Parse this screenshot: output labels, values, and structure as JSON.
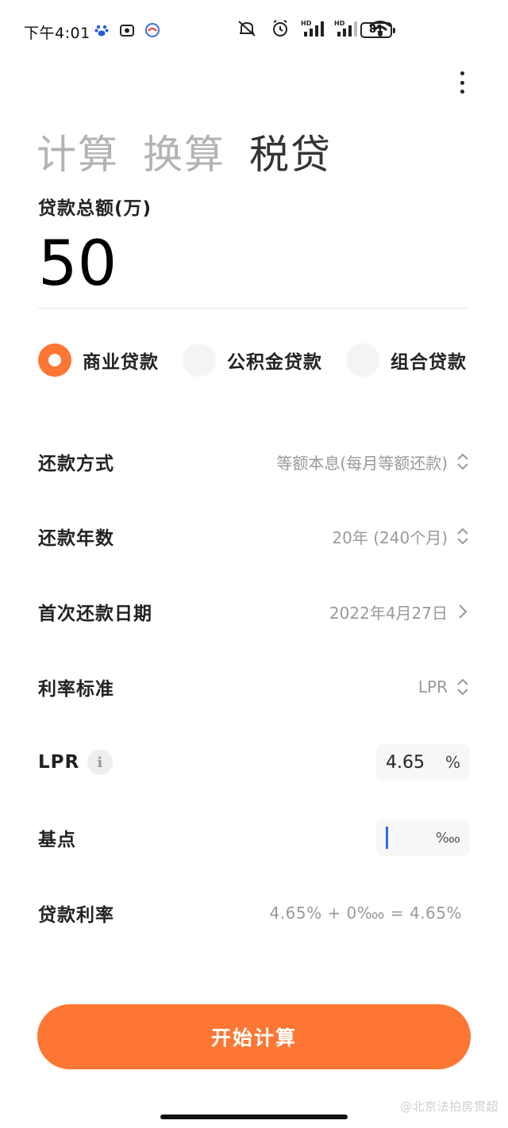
{
  "status_bar": {
    "time": "下午4:01",
    "battery": "81",
    "net_hd_1": "HD",
    "net_hd_2": "HD"
  },
  "tabs": [
    {
      "label": "计算",
      "active": false
    },
    {
      "label": "换算",
      "active": false
    },
    {
      "label": "税贷",
      "active": true
    }
  ],
  "amount": {
    "label": "贷款总额(万)",
    "value": "50"
  },
  "loan_types": [
    {
      "label": "商业贷款",
      "checked": true
    },
    {
      "label": "公积金贷款",
      "checked": false
    },
    {
      "label": "组合贷款",
      "checked": false
    }
  ],
  "fields": {
    "repay_method": {
      "label": "还款方式",
      "value": "等额本息(每月等额还款)"
    },
    "repay_years": {
      "label": "还款年数",
      "value": "20年 (240个月)"
    },
    "first_date": {
      "label": "首次还款日期",
      "value": "2022年4月27日"
    },
    "rate_standard": {
      "label": "利率标准",
      "value": "LPR"
    },
    "lpr": {
      "label": "LPR",
      "value": "4.65",
      "unit": "%",
      "info_icon": "i"
    },
    "basis_point": {
      "label": "基点",
      "value": "",
      "unit": "‱"
    },
    "loan_rate": {
      "label": "贷款利率",
      "value": "4.65% + 0‱ = 4.65%"
    }
  },
  "start_button": "开始计算",
  "watermark": "@北京法拍房贯超",
  "colors": {
    "accent": "#fd7633",
    "text_primary": "#222222",
    "text_secondary": "#999999"
  }
}
